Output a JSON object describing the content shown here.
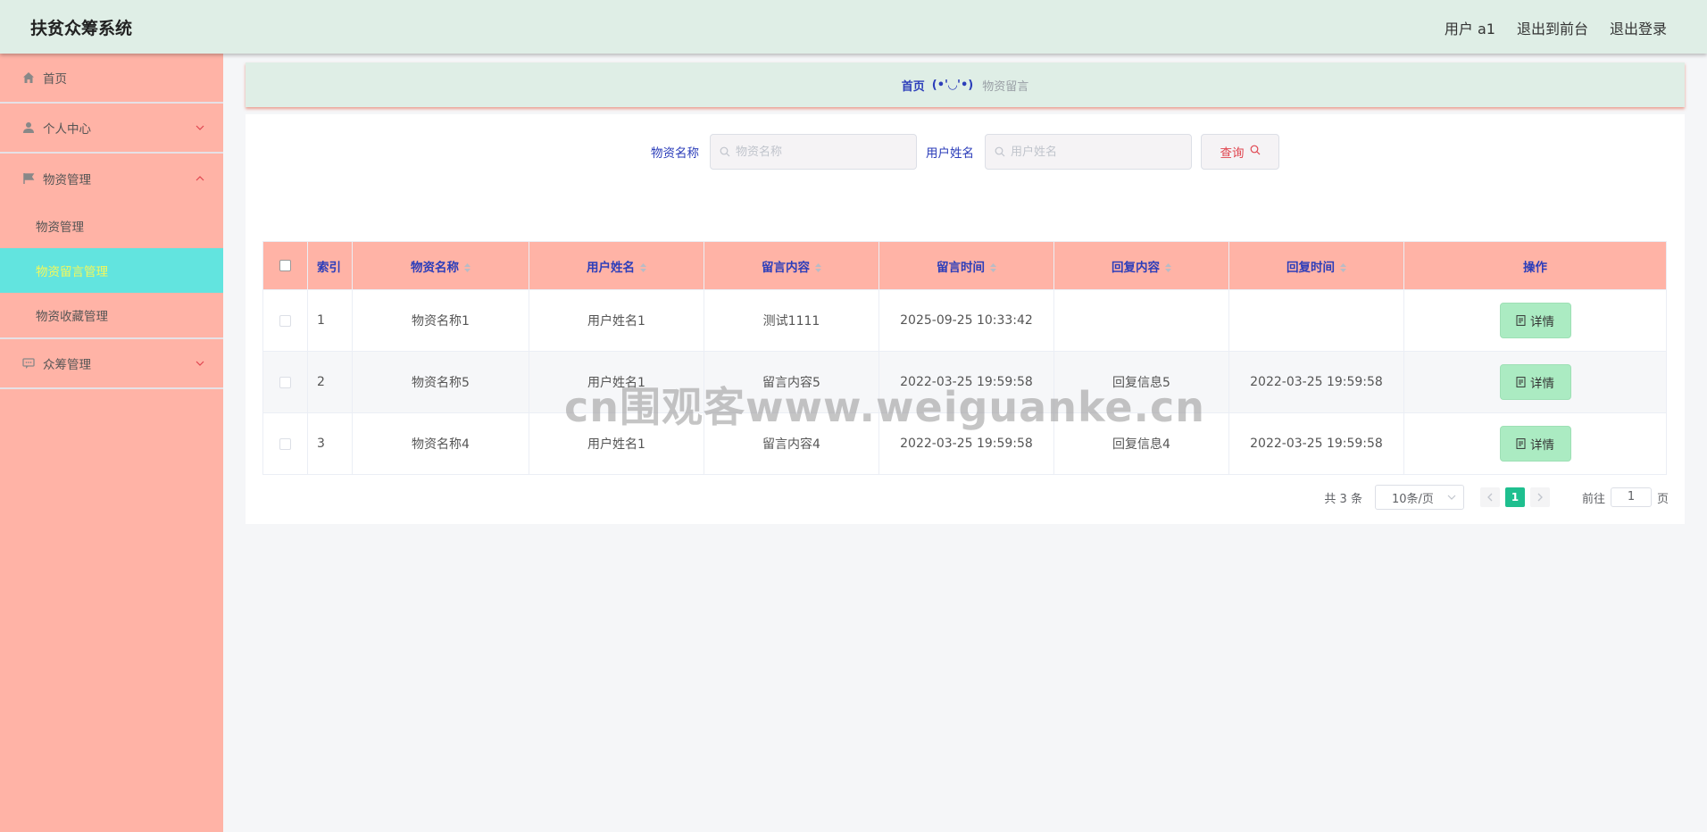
{
  "header": {
    "title": "扶贫众筹系统",
    "user_label": "用户 a1",
    "to_front": "退出到前台",
    "logout": "退出登录"
  },
  "sidebar": {
    "home": "首页",
    "personal_center": "个人中心",
    "material_mgmt": "物资管理",
    "sub_items": [
      "物资管理",
      "物资留言管理",
      "物资收藏管理"
    ],
    "active_sub": "物资留言管理",
    "crowdfunding_mgmt": "众筹管理"
  },
  "breadcrumb": {
    "home": "首页",
    "face": "(•'◡'•)",
    "current": "物资留言"
  },
  "search": {
    "name_label": "物资名称",
    "name_placeholder": "物资名称",
    "user_label": "用户姓名",
    "user_placeholder": "用户姓名",
    "query_label": "查询"
  },
  "table": {
    "columns": [
      "索引",
      "物资名称",
      "用户姓名",
      "留言内容",
      "留言时间",
      "回复内容",
      "回复时间",
      "操作"
    ],
    "rows": [
      {
        "index": "1",
        "name": "物资名称1",
        "user": "用户姓名1",
        "content": "测试1111",
        "time": "2025-09-25 10:33:42",
        "reply": "",
        "reply_time": ""
      },
      {
        "index": "2",
        "name": "物资名称5",
        "user": "用户姓名1",
        "content": "留言内容5",
        "time": "2022-03-25 19:59:58",
        "reply": "回复信息5",
        "reply_time": "2022-03-25 19:59:58"
      },
      {
        "index": "3",
        "name": "物资名称4",
        "user": "用户姓名1",
        "content": "留言内容4",
        "time": "2022-03-25 19:59:58",
        "reply": "回复信息4",
        "reply_time": "2022-03-25 19:59:58"
      }
    ],
    "detail_label": "详情"
  },
  "pagination": {
    "total": "共 3 条",
    "page_size": "10条/页",
    "current_page": "1",
    "goto_label": "前往",
    "goto_value": "1",
    "page_suffix": "页"
  },
  "watermark": "cn围观客www.weiguanke.cn",
  "colors": {
    "header_bg": "#dfeee6",
    "sidebar_bg": "#ffb3a6",
    "active_bg": "#62e4df",
    "active_text": "#f4f85a",
    "label_blue": "#2c3eba",
    "detail_btn": "#abebc2",
    "page_active": "#1fbf8f"
  }
}
